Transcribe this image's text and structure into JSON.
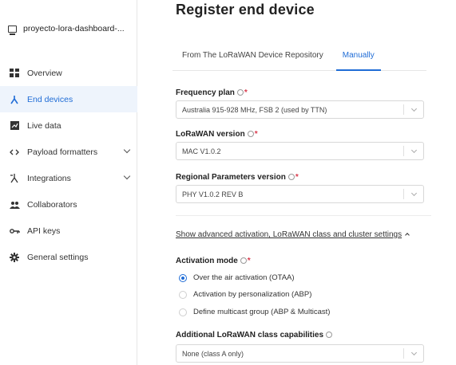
{
  "app": {
    "name": "proyecto-lora-dashboard-..."
  },
  "sidebar": {
    "items": [
      {
        "label": "Overview",
        "icon": "overview-icon"
      },
      {
        "label": "End devices",
        "icon": "end-devices-icon",
        "active": true
      },
      {
        "label": "Live data",
        "icon": "live-data-icon"
      },
      {
        "label": "Payload formatters",
        "icon": "code-icon",
        "expandable": true
      },
      {
        "label": "Integrations",
        "icon": "integrations-icon",
        "expandable": true
      },
      {
        "label": "Collaborators",
        "icon": "collaborators-icon"
      },
      {
        "label": "API keys",
        "icon": "key-icon"
      },
      {
        "label": "General settings",
        "icon": "gear-icon"
      }
    ]
  },
  "page": {
    "title": "Register end device"
  },
  "tabs": [
    {
      "label": "From The LoRaWAN Device Repository",
      "active": false
    },
    {
      "label": "Manually",
      "active": true
    }
  ],
  "form": {
    "frequency_plan": {
      "label": "Frequency plan",
      "value": "Australia 915-928 MHz, FSB 2 (used by TTN)"
    },
    "lorawan_version": {
      "label": "LoRaWAN version",
      "value": "MAC V1.0.2"
    },
    "regional_params": {
      "label": "Regional Parameters version",
      "value": "PHY V1.0.2 REV B"
    },
    "advanced_link": "Show advanced activation, LoRaWAN class and cluster settings",
    "activation_mode": {
      "label": "Activation mode",
      "options": [
        {
          "label": "Over the air activation (OTAA)",
          "selected": true
        },
        {
          "label": "Activation by personalization (ABP)",
          "selected": false
        },
        {
          "label": "Define multicast group (ABP & Multicast)",
          "selected": false
        }
      ]
    },
    "class_capabilities": {
      "label": "Additional LoRaWAN class capabilities",
      "value": "None (class A only)"
    },
    "required_mark": "*"
  },
  "colors": {
    "accent": "#1f6cd6",
    "required": "#d9394c",
    "active_bg": "#eef4fc"
  }
}
